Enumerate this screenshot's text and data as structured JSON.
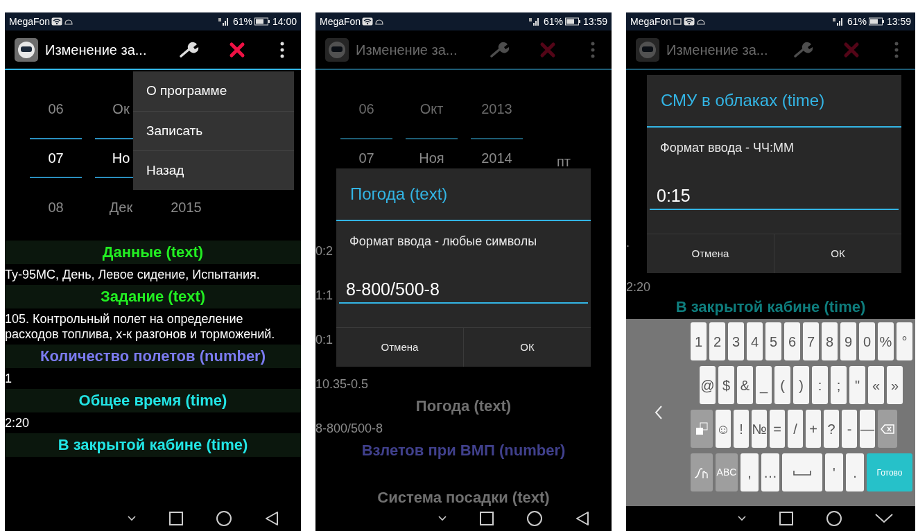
{
  "phones": [
    {
      "status_bar": {
        "carrier": "MegaFon",
        "screenshot_notification": false,
        "battery": "61%",
        "time": "14:00"
      },
      "action_bar": {
        "title": "Изменение за..."
      },
      "dimmed": false,
      "date_picker": {
        "rows": [
          {
            "selected": false,
            "cells": [
              "06",
              "Ок"
            ]
          },
          {
            "selected": true,
            "cells": [
              "07",
              "Но"
            ]
          },
          {
            "selected": false,
            "cells": [
              "08",
              "Дек",
              "2015"
            ]
          }
        ]
      },
      "list": [
        {
          "kind": "header",
          "text": "Данные (text)",
          "color": "#22ee22"
        },
        {
          "kind": "value",
          "text": "Ту-95МС, День, Левое сидение, Испытания."
        },
        {
          "kind": "header",
          "text": "Задание (text)",
          "color": "#22ee22"
        },
        {
          "kind": "value",
          "text": "105. Контрольный полет на определение расходов топлива, х-к разгонов и торможений."
        },
        {
          "kind": "header",
          "text": "Количество полетов (number)",
          "color": "#7b7bf0"
        },
        {
          "kind": "value",
          "text": "1"
        },
        {
          "kind": "header",
          "text": "Общее время (time)",
          "color": "#22e5e5"
        },
        {
          "kind": "value",
          "text": "2:20"
        },
        {
          "kind": "header",
          "text": "В закрытой кабине (time)",
          "color": "#22e5e5"
        }
      ],
      "menu": [
        "О программе",
        "Записать",
        "Назад"
      ],
      "nav_bar": {
        "kind": "back"
      }
    },
    {
      "status_bar": {
        "carrier": "MegaFon",
        "screenshot_notification": false,
        "battery": "61%",
        "time": "13:59"
      },
      "action_bar": {
        "title": "Изменение за..."
      },
      "dimmed": true,
      "date_picker": {
        "rows": [
          {
            "selected": false,
            "cells": [
              "06",
              "Окт",
              "2013"
            ]
          },
          {
            "selected": true,
            "cells": [
              "07",
              "Ноя",
              "2014",
              "пт"
            ]
          }
        ]
      },
      "list": [
        {
          "kind": "value",
          "text": "0:2"
        },
        {
          "kind": "gap"
        },
        {
          "kind": "value",
          "text": "1:1"
        },
        {
          "kind": "gap"
        },
        {
          "kind": "value",
          "text": "0:1"
        },
        {
          "kind": "gap"
        },
        {
          "kind": "value",
          "text": "10.35-0.5"
        },
        {
          "kind": "header",
          "text": "Погода (text)",
          "color": "#707070"
        },
        {
          "kind": "value",
          "text": "8-800/500-8"
        },
        {
          "kind": "header",
          "text": "Взлетов при ВМП (number)",
          "color": "#40408c"
        },
        {
          "kind": "gap"
        },
        {
          "kind": "header",
          "text": "Система посадки (text)",
          "color": "#707070"
        }
      ],
      "dialog": {
        "title": "Погода (text)",
        "message": "Формат ввода - любые символы",
        "value": "8-800/500-8",
        "buttons": [
          "Отмена",
          "ОК"
        ]
      },
      "nav_bar": {
        "kind": "back"
      }
    },
    {
      "status_bar": {
        "carrier": "MegaFon",
        "screenshot_notification": true,
        "battery": "61%",
        "time": "13:59"
      },
      "action_bar": {
        "title": "Изменение за..."
      },
      "dimmed": true,
      "list": [
        {
          "kind": "value",
          "text": "."
        },
        {
          "kind": "gap"
        },
        {
          "kind": "value",
          "text": "2:20"
        },
        {
          "kind": "header",
          "text": "В закрытой кабине (time)",
          "color": "#0e7d7d"
        }
      ],
      "dialog": {
        "title": "СМУ в облаках (time)",
        "message": "Формат ввода - ЧЧ:ММ",
        "value": "0:15",
        "buttons": [
          "Отмена",
          "ОК"
        ]
      },
      "keyboard": {
        "rows": [
          {
            "keys": [
              {
                "kind": "char",
                "label": "1"
              },
              {
                "kind": "char",
                "label": "2"
              },
              {
                "kind": "char",
                "label": "3"
              },
              {
                "kind": "char",
                "label": "4"
              },
              {
                "kind": "char",
                "label": "5"
              },
              {
                "kind": "char",
                "label": "6"
              },
              {
                "kind": "char",
                "label": "7"
              },
              {
                "kind": "char",
                "label": "8"
              },
              {
                "kind": "char",
                "label": "9"
              },
              {
                "kind": "char",
                "label": "0"
              },
              {
                "kind": "char",
                "label": "%"
              },
              {
                "kind": "char",
                "label": "°"
              }
            ]
          },
          {
            "keys": [
              {
                "kind": "char",
                "label": "@"
              },
              {
                "kind": "char",
                "label": "$"
              },
              {
                "kind": "char",
                "label": "&"
              },
              {
                "kind": "char",
                "label": "_"
              },
              {
                "kind": "char",
                "label": "("
              },
              {
                "kind": "char",
                "label": ")"
              },
              {
                "kind": "char",
                "label": ":"
              },
              {
                "kind": "char",
                "label": ";"
              },
              {
                "kind": "char",
                "label": "\""
              },
              {
                "kind": "char",
                "label": "«"
              },
              {
                "kind": "char",
                "label": "»"
              }
            ]
          },
          {
            "keys": [
              {
                "kind": "layout"
              },
              {
                "kind": "char",
                "label": "☺"
              },
              {
                "kind": "char",
                "label": "!"
              },
              {
                "kind": "char",
                "label": "№"
              },
              {
                "kind": "char",
                "label": "="
              },
              {
                "kind": "char",
                "label": "/"
              },
              {
                "kind": "char",
                "label": "+"
              },
              {
                "kind": "char",
                "label": "?"
              },
              {
                "kind": "char",
                "label": "-"
              },
              {
                "kind": "char",
                "label": "—"
              },
              {
                "kind": "backspace"
              }
            ]
          },
          {
            "keys": [
              {
                "kind": "gesture"
              },
              {
                "kind": "mode",
                "label": "ABC"
              },
              {
                "kind": "char",
                "label": ","
              },
              {
                "kind": "char",
                "label": "…"
              },
              {
                "kind": "space"
              },
              {
                "kind": "char",
                "label": "'"
              },
              {
                "kind": "char",
                "label": "."
              },
              {
                "kind": "done",
                "label": "Готово"
              }
            ]
          }
        ]
      },
      "nav_bar": {
        "kind": "hide"
      }
    }
  ]
}
